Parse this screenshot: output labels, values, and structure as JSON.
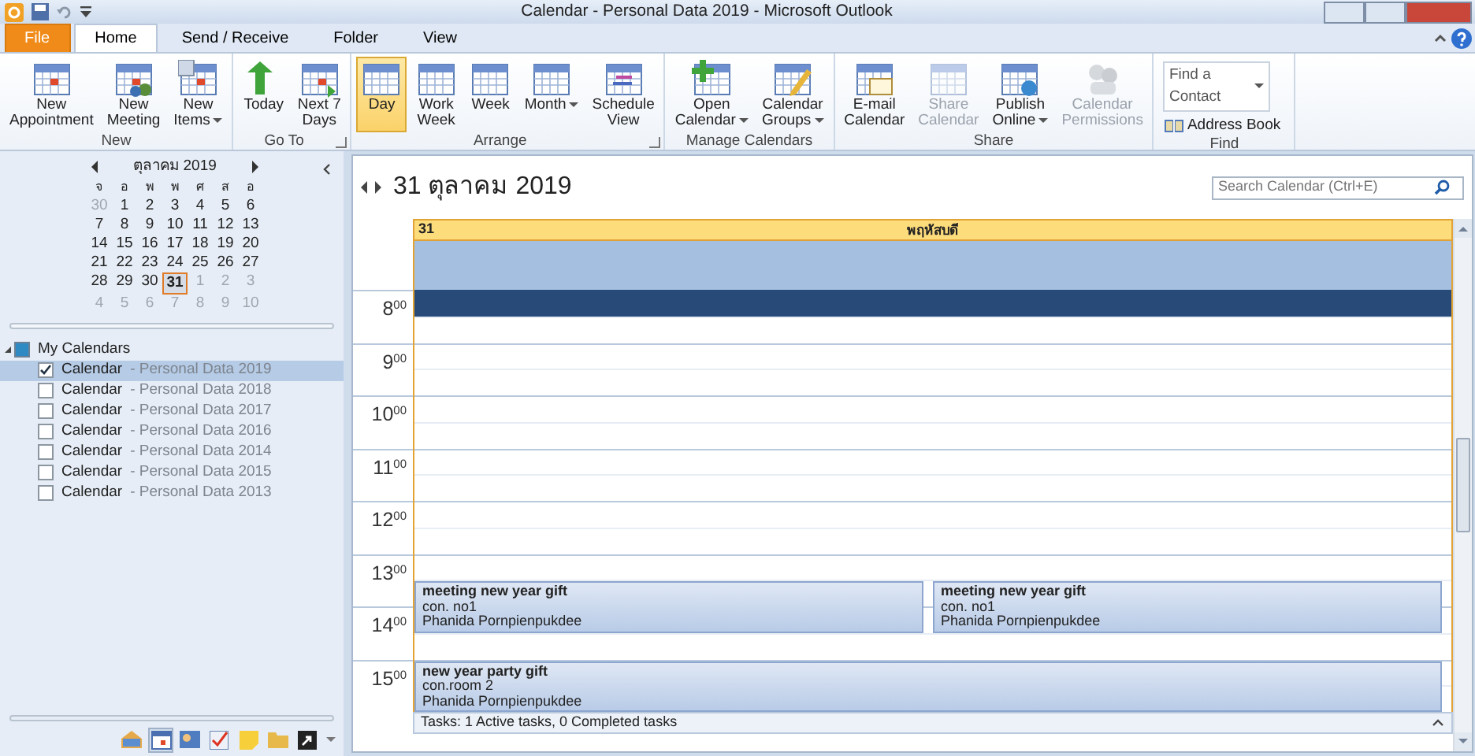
{
  "window": {
    "title": "Calendar - Personal Data 2019  -  Microsoft Outlook"
  },
  "ribbon_tabs": [
    {
      "label": "File",
      "kind": "file",
      "selected": false
    },
    {
      "label": "Home",
      "kind": "tab",
      "selected": true
    },
    {
      "label": "Send / Receive",
      "kind": "tab",
      "selected": false
    },
    {
      "label": "Folder",
      "kind": "tab",
      "selected": false
    },
    {
      "label": "View",
      "kind": "tab",
      "selected": false
    }
  ],
  "ribbon_groups": [
    {
      "label": "New",
      "kind": "buttons",
      "launcher": false,
      "buttons": [
        {
          "lines": [
            "New",
            "Appointment"
          ],
          "dropdown": false,
          "disabled": false,
          "selected": false
        },
        {
          "lines": [
            "New",
            "Meeting"
          ],
          "dropdown": false,
          "disabled": false,
          "selected": false
        },
        {
          "lines": [
            "New",
            "Items"
          ],
          "dropdown": true,
          "disabled": false,
          "selected": false
        }
      ]
    },
    {
      "label": "Go To",
      "kind": "buttons",
      "launcher": true,
      "buttons": [
        {
          "lines": [
            "Today"
          ],
          "dropdown": false,
          "disabled": false,
          "selected": false
        },
        {
          "lines": [
            "Next 7",
            "Days"
          ],
          "dropdown": false,
          "disabled": false,
          "selected": false
        }
      ]
    },
    {
      "label": "Arrange",
      "kind": "buttons",
      "launcher": true,
      "buttons": [
        {
          "lines": [
            "Day"
          ],
          "dropdown": false,
          "disabled": false,
          "selected": true
        },
        {
          "lines": [
            "Work",
            "Week"
          ],
          "dropdown": false,
          "disabled": false,
          "selected": false
        },
        {
          "lines": [
            "Week"
          ],
          "dropdown": false,
          "disabled": false,
          "selected": false
        },
        {
          "lines": [
            "Month"
          ],
          "dropdown": true,
          "disabled": false,
          "selected": false
        },
        {
          "lines": [
            "Schedule",
            "View"
          ],
          "dropdown": false,
          "disabled": false,
          "selected": false
        }
      ]
    },
    {
      "label": "Manage Calendars",
      "kind": "buttons",
      "launcher": false,
      "buttons": [
        {
          "lines": [
            "Open",
            "Calendar"
          ],
          "dropdown": true,
          "disabled": false,
          "selected": false
        },
        {
          "lines": [
            "Calendar",
            "Groups"
          ],
          "dropdown": true,
          "disabled": false,
          "selected": false
        }
      ]
    },
    {
      "label": "Share",
      "kind": "buttons",
      "launcher": false,
      "buttons": [
        {
          "lines": [
            "E-mail",
            "Calendar"
          ],
          "dropdown": false,
          "disabled": false,
          "selected": false
        },
        {
          "lines": [
            "Share",
            "Calendar"
          ],
          "dropdown": false,
          "disabled": true,
          "selected": false
        },
        {
          "lines": [
            "Publish",
            "Online"
          ],
          "dropdown": true,
          "disabled": false,
          "selected": false
        },
        {
          "lines": [
            "Calendar",
            "Permissions"
          ],
          "dropdown": false,
          "disabled": true,
          "selected": false
        }
      ]
    },
    {
      "label": "Find",
      "kind": "find",
      "launcher": false,
      "contact_box": {
        "placeholder": "Find a Contact"
      },
      "address_book": "Address Book"
    }
  ],
  "mini_calendar": {
    "month": "ตุลาคม 2019",
    "weekdays": [
      "จ",
      "อ",
      "พ",
      "พ",
      "ศ",
      "ส",
      "อ"
    ],
    "weeks": [
      [
        {
          "day": "30",
          "muted": true,
          "selected": false
        },
        {
          "day": "1",
          "muted": false,
          "selected": false
        },
        {
          "day": "2",
          "muted": false,
          "selected": false
        },
        {
          "day": "3",
          "muted": false,
          "selected": false
        },
        {
          "day": "4",
          "muted": false,
          "selected": false
        },
        {
          "day": "5",
          "muted": false,
          "selected": false
        },
        {
          "day": "6",
          "muted": false,
          "selected": false
        }
      ],
      [
        {
          "day": "7",
          "muted": false,
          "selected": false
        },
        {
          "day": "8",
          "muted": false,
          "selected": false
        },
        {
          "day": "9",
          "muted": false,
          "selected": false
        },
        {
          "day": "10",
          "muted": false,
          "selected": false
        },
        {
          "day": "11",
          "muted": false,
          "selected": false
        },
        {
          "day": "12",
          "muted": false,
          "selected": false
        },
        {
          "day": "13",
          "muted": false,
          "selected": false
        }
      ],
      [
        {
          "day": "14",
          "muted": false,
          "selected": false
        },
        {
          "day": "15",
          "muted": false,
          "selected": false
        },
        {
          "day": "16",
          "muted": false,
          "selected": false
        },
        {
          "day": "17",
          "muted": false,
          "selected": false
        },
        {
          "day": "18",
          "muted": false,
          "selected": false
        },
        {
          "day": "19",
          "muted": false,
          "selected": false
        },
        {
          "day": "20",
          "muted": false,
          "selected": false
        }
      ],
      [
        {
          "day": "21",
          "muted": false,
          "selected": false
        },
        {
          "day": "22",
          "muted": false,
          "selected": false
        },
        {
          "day": "23",
          "muted": false,
          "selected": false
        },
        {
          "day": "24",
          "muted": false,
          "selected": false
        },
        {
          "day": "25",
          "muted": false,
          "selected": false
        },
        {
          "day": "26",
          "muted": false,
          "selected": false
        },
        {
          "day": "27",
          "muted": false,
          "selected": false
        }
      ],
      [
        {
          "day": "28",
          "muted": false,
          "selected": false
        },
        {
          "day": "29",
          "muted": false,
          "selected": false
        },
        {
          "day": "30",
          "muted": false,
          "selected": false
        },
        {
          "day": "31",
          "muted": false,
          "selected": true
        },
        {
          "day": "1",
          "muted": true,
          "selected": false
        },
        {
          "day": "2",
          "muted": true,
          "selected": false
        },
        {
          "day": "3",
          "muted": true,
          "selected": false
        }
      ],
      [
        {
          "day": "4",
          "muted": true,
          "selected": false
        },
        {
          "day": "5",
          "muted": true,
          "selected": false
        },
        {
          "day": "6",
          "muted": true,
          "selected": false
        },
        {
          "day": "7",
          "muted": true,
          "selected": false
        },
        {
          "day": "8",
          "muted": true,
          "selected": false
        },
        {
          "day": "9",
          "muted": true,
          "selected": false
        },
        {
          "day": "10",
          "muted": true,
          "selected": false
        }
      ]
    ]
  },
  "calendar_group": {
    "label": "My Calendars",
    "expanded": true,
    "items": [
      {
        "name": "Calendar",
        "detail": "- Personal Data 2019",
        "checked": true,
        "selected": true
      },
      {
        "name": "Calendar",
        "detail": "- Personal Data 2018",
        "checked": false,
        "selected": false
      },
      {
        "name": "Calendar",
        "detail": "- Personal Data 2017",
        "checked": false,
        "selected": false
      },
      {
        "name": "Calendar",
        "detail": "- Personal Data 2016",
        "checked": false,
        "selected": false
      },
      {
        "name": "Calendar",
        "detail": "- Personal Data 2014",
        "checked": false,
        "selected": false
      },
      {
        "name": "Calendar",
        "detail": "- Personal Data 2015",
        "checked": false,
        "selected": false
      },
      {
        "name": "Calendar",
        "detail": "- Personal Data 2013",
        "checked": false,
        "selected": false
      }
    ]
  },
  "nav_buttons": [
    {
      "selected": false
    },
    {
      "selected": true
    },
    {
      "selected": false
    },
    {
      "selected": false
    },
    {
      "selected": false
    },
    {
      "selected": false
    },
    {
      "selected": false
    }
  ],
  "day_view": {
    "date_title": "31 ตุลาคม 2019",
    "search": {
      "placeholder": "Search Calendar (Ctrl+E)"
    },
    "day_header": {
      "day": "31",
      "weekday": "พฤหัสบดี"
    },
    "hours": [
      {
        "label": "8$^{00}$",
        "selected": true
      },
      {
        "label": "9$^{00}$",
        "selected": false
      },
      {
        "label": "10$^{00}$",
        "selected": false
      },
      {
        "label": "11$^{00}$",
        "selected": false
      },
      {
        "label": "12$^{00}$",
        "selected": false
      },
      {
        "label": "13$^{00}$",
        "selected": false,
        "events": [
          {
            "title": "meeting new year gift",
            "location": "con. no1",
            "organizer": "Phanida Pornpienpukdee",
            "half_past": true
          },
          {
            "title": "meeting new year gift",
            "location": "con. no1",
            "organizer": "Phanida Pornpienpukdee",
            "half_past": true
          }
        ]
      },
      {
        "label": "14$^{00}$",
        "selected": false
      },
      {
        "label": "15$^{00}$",
        "selected": false,
        "events": [
          {
            "title": "new year party gift",
            "location": "con.room 2",
            "organizer": "Phanida Pornpienpukdee",
            "half_past": false
          }
        ]
      }
    ]
  },
  "tasks_bar": "Tasks: 1 Active tasks, 0 Completed tasks"
}
